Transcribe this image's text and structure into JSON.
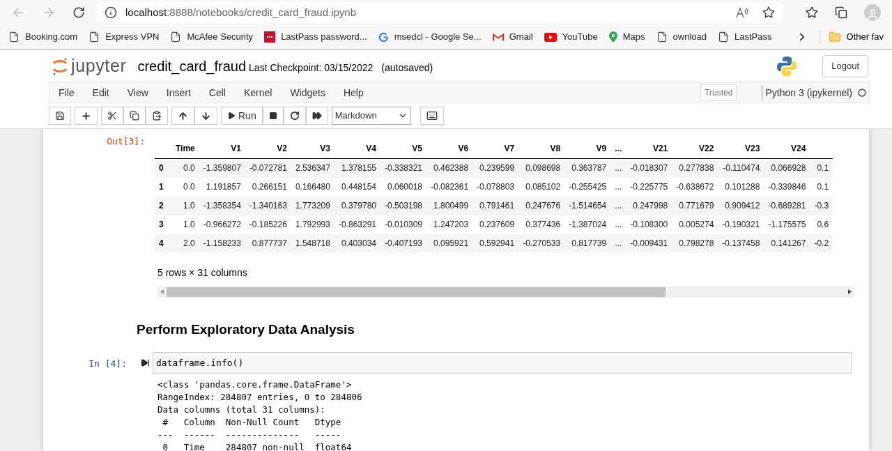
{
  "browser": {
    "url_host": "localhost",
    "url_path": ":8888/notebooks/credit_card_fraud.ipynb",
    "bookmarks": [
      {
        "label": "Booking.com",
        "kind": "page"
      },
      {
        "label": "Express VPN",
        "kind": "page"
      },
      {
        "label": "McAfee Security",
        "kind": "page"
      },
      {
        "label": "LastPass password...",
        "kind": "lastpass"
      },
      {
        "label": "msedcl - Google Se...",
        "kind": "google"
      },
      {
        "label": "Gmail",
        "kind": "gmail"
      },
      {
        "label": "YouTube",
        "kind": "youtube"
      },
      {
        "label": "Maps",
        "kind": "maps"
      },
      {
        "label": "ownload",
        "kind": "page"
      },
      {
        "label": "LastPass",
        "kind": "page"
      }
    ],
    "other_favorites": "Other fav"
  },
  "header": {
    "logo_text": "jupyter",
    "notebook_name": "credit_card_fraud",
    "checkpoint": "Last Checkpoint: 03/15/2022",
    "autosave": "(autosaved)",
    "logout": "Logout"
  },
  "menu": [
    "File",
    "Edit",
    "View",
    "Insert",
    "Cell",
    "Kernel",
    "Widgets",
    "Help"
  ],
  "trusted": "Trusted",
  "kernel": "Python 3 (ipykernel)",
  "toolbar": {
    "run": "Run",
    "cell_type": "Markdown"
  },
  "output": {
    "prompt": "Out[3]:",
    "columns": [
      "Time",
      "V1",
      "V2",
      "V3",
      "V4",
      "V5",
      "V6",
      "V7",
      "V8",
      "V9",
      "...",
      "V21",
      "V22",
      "V23",
      "V24"
    ],
    "rows": [
      {
        "index": "0",
        "cells": [
          "0.0",
          "-1.359807",
          "-0.072781",
          "2.536347",
          "1.378155",
          "-0.338321",
          "0.462388",
          "0.239599",
          "0.098698",
          "0.363787",
          "...",
          "-0.018307",
          "0.277838",
          "-0.110474",
          "0.066928",
          "0.1"
        ]
      },
      {
        "index": "1",
        "cells": [
          "0.0",
          "1.191857",
          "0.266151",
          "0.166480",
          "0.448154",
          "0.060018",
          "-0.082361",
          "-0.078803",
          "0.085102",
          "-0.255425",
          "...",
          "-0.225775",
          "-0.638672",
          "0.101288",
          "-0.339846",
          "0.1"
        ]
      },
      {
        "index": "2",
        "cells": [
          "1.0",
          "-1.358354",
          "-1.340163",
          "1.773209",
          "0.379780",
          "-0.503198",
          "1.800499",
          "0.791461",
          "0.247676",
          "-1.514654",
          "...",
          "0.247998",
          "0.771679",
          "0.909412",
          "-0.689281",
          "-0.3"
        ]
      },
      {
        "index": "3",
        "cells": [
          "1.0",
          "-0.966272",
          "-0.185226",
          "1.792993",
          "-0.863291",
          "-0.010309",
          "1.247203",
          "0.237609",
          "0.377436",
          "-1.387024",
          "...",
          "-0.108300",
          "0.005274",
          "-0.190321",
          "-1.175575",
          "0.6"
        ]
      },
      {
        "index": "4",
        "cells": [
          "2.0",
          "-1.158233",
          "0.877737",
          "1.548718",
          "0.403034",
          "-0.407193",
          "0.095921",
          "0.592941",
          "-0.270533",
          "0.817739",
          "...",
          "-0.009431",
          "0.798278",
          "-0.137458",
          "0.141267",
          "-0.2"
        ]
      }
    ],
    "shape": "5 rows × 31 columns"
  },
  "markdown_heading": "Perform Exploratory Data Analysis",
  "code_cell": {
    "prompt": "In [4]:",
    "code": "dataframe.info()",
    "output_lines": [
      "<class 'pandas.core.frame.DataFrame'>",
      "RangeIndex: 284807 entries, 0 to 284806",
      "Data columns (total 31 columns):",
      " #   Column  Non-Null Count   Dtype  ",
      "---  ------  --------------   -----  ",
      " 0   Time    284807 non-null  float64"
    ]
  }
}
